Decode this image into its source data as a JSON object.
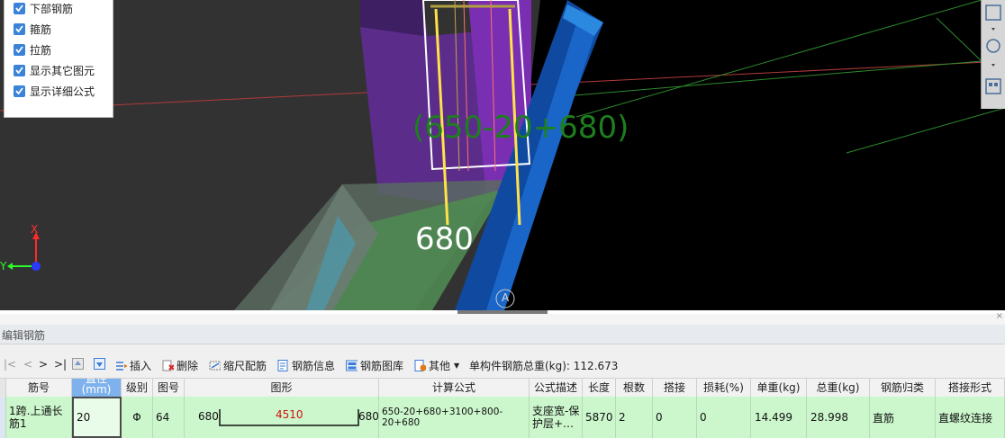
{
  "viewport": {
    "checkbox_panel": {
      "items": [
        {
          "label": "下部钢筋",
          "checked": true
        },
        {
          "label": "箍筋",
          "checked": true
        },
        {
          "label": "拉筋",
          "checked": true
        },
        {
          "label": "显示其它图元",
          "checked": true
        },
        {
          "label": "显示详细公式",
          "checked": true
        }
      ]
    },
    "formula_label": "(650-20+680)",
    "dimension_label": "680",
    "axis_x": "X",
    "axis_y": "Y",
    "grid_label": "A"
  },
  "panel": {
    "title": "编辑钢筋"
  },
  "toolbar": {
    "nav_first": "|<",
    "nav_prev": "<",
    "nav_next": ">",
    "nav_last": ">|",
    "insert": "插入",
    "delete": "删除",
    "scale_rebar": "缩尺配筋",
    "rebar_info": "钢筋信息",
    "rebar_library": "钢筋图库",
    "other": "其他",
    "total_weight": "单构件钢筋总重(kg): 112.673"
  },
  "table": {
    "headers": [
      "筋号",
      "直径(mm)",
      "级别",
      "图号",
      "图形",
      "计算公式",
      "公式描述",
      "长度",
      "根数",
      "搭接",
      "损耗(%)",
      "单重(kg)",
      "总重(kg)",
      "钢筋归类",
      "搭接形式"
    ],
    "row": {
      "bar_no": "1跨.上通长筋1",
      "diameter": "20",
      "grade": "Φ",
      "fig_no": "64",
      "shape_left": "680",
      "shape_mid": "4510",
      "shape_right": "680",
      "formula": "650-20+680+3100+800-20+680",
      "formula_desc": "支座宽-保护层+…",
      "length": "5870",
      "count": "2",
      "lap": "0",
      "loss": "0",
      "unit_weight": "14.499",
      "total_weight": "28.998",
      "category": "直筋",
      "lap_type": "直螺纹连接"
    }
  }
}
